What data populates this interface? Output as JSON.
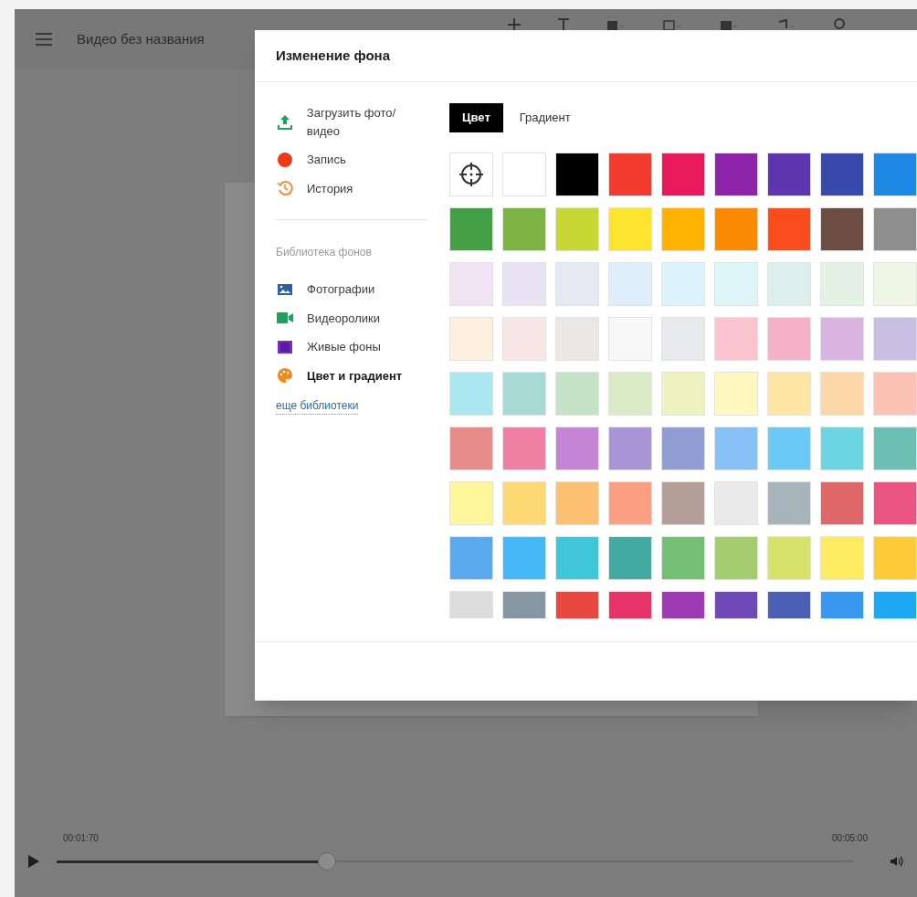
{
  "app_bar": {
    "title": "Видео без названия"
  },
  "dialog": {
    "title": "Изменение фона",
    "sources": [
      {
        "kind": "upload",
        "label": "Загрузить фото/видео"
      },
      {
        "kind": "record",
        "label": "Запись"
      },
      {
        "kind": "history",
        "label": "История"
      }
    ],
    "library_heading": "Библиотека фонов",
    "libraries": [
      {
        "kind": "photos",
        "label": "Фотографии",
        "selected": false
      },
      {
        "kind": "videos",
        "label": "Видеоролики",
        "selected": false
      },
      {
        "kind": "live",
        "label": "Живые фоны",
        "selected": false
      },
      {
        "kind": "palette",
        "label": "Цвет и градиент",
        "selected": true
      }
    ],
    "more_link": "еще библиотеки",
    "tabs": [
      {
        "label": "Цвет",
        "selected": true
      },
      {
        "label": "Градиент",
        "selected": false
      }
    ],
    "swatches": [
      {
        "kind": "picker"
      },
      {
        "kind": "color",
        "color": "#ffffff"
      },
      {
        "kind": "color",
        "color": "#000000"
      },
      {
        "kind": "color",
        "color": "#f33a2f"
      },
      {
        "kind": "color",
        "color": "#e91a5c"
      },
      {
        "kind": "color",
        "color": "#8e24aa"
      },
      {
        "kind": "color",
        "color": "#5e35b1"
      },
      {
        "kind": "color",
        "color": "#3949ab"
      },
      {
        "kind": "color",
        "color": "#1e88e5"
      },
      {
        "kind": "color",
        "color": "#43a047"
      },
      {
        "kind": "color",
        "color": "#7cb342"
      },
      {
        "kind": "color",
        "color": "#c6d632"
      },
      {
        "kind": "color",
        "color": "#fde42e"
      },
      {
        "kind": "color",
        "color": "#ffb300"
      },
      {
        "kind": "color",
        "color": "#fb8a00"
      },
      {
        "kind": "color",
        "color": "#fb4c1e"
      },
      {
        "kind": "color",
        "color": "#6d4c41"
      },
      {
        "kind": "color",
        "color": "#8e8e8e"
      },
      {
        "kind": "color",
        "color": "#f1e3f4"
      },
      {
        "kind": "color",
        "color": "#e8e4f4"
      },
      {
        "kind": "color",
        "color": "#e6e9f4"
      },
      {
        "kind": "color",
        "color": "#deeefa"
      },
      {
        "kind": "color",
        "color": "#dcf3fb"
      },
      {
        "kind": "color",
        "color": "#dcf5f7"
      },
      {
        "kind": "color",
        "color": "#dcefed"
      },
      {
        "kind": "color",
        "color": "#e4f2e5"
      },
      {
        "kind": "color",
        "color": "#eef6e6"
      },
      {
        "kind": "color",
        "color": "#fef0df"
      },
      {
        "kind": "color",
        "color": "#f9e6e6"
      },
      {
        "kind": "color",
        "color": "#ebe7e5"
      },
      {
        "kind": "color",
        "color": "#f8f8f8"
      },
      {
        "kind": "color",
        "color": "#e8e9ec"
      },
      {
        "kind": "color",
        "color": "#fcc4cf"
      },
      {
        "kind": "color",
        "color": "#f4b1c8"
      },
      {
        "kind": "color",
        "color": "#dab4e1"
      },
      {
        "kind": "color",
        "color": "#c9bfe2"
      },
      {
        "kind": "color",
        "color": "#abe7f0"
      },
      {
        "kind": "color",
        "color": "#a8dad5"
      },
      {
        "kind": "color",
        "color": "#c4e2c6"
      },
      {
        "kind": "color",
        "color": "#d9ebc6"
      },
      {
        "kind": "color",
        "color": "#eff3c0"
      },
      {
        "kind": "color",
        "color": "#fff8c0"
      },
      {
        "kind": "color",
        "color": "#fde5a6"
      },
      {
        "kind": "color",
        "color": "#fcd8a8"
      },
      {
        "kind": "color",
        "color": "#fbc3b3"
      },
      {
        "kind": "color",
        "color": "#e88b8b"
      },
      {
        "kind": "color",
        "color": "#f07fa4"
      },
      {
        "kind": "color",
        "color": "#c584d4"
      },
      {
        "kind": "color",
        "color": "#a994d6"
      },
      {
        "kind": "color",
        "color": "#8f9dd2"
      },
      {
        "kind": "color",
        "color": "#86c0f5"
      },
      {
        "kind": "color",
        "color": "#6cc8f5"
      },
      {
        "kind": "color",
        "color": "#6cd5e3"
      },
      {
        "kind": "color",
        "color": "#6bbfb3"
      },
      {
        "kind": "color",
        "color": "#fff59a"
      },
      {
        "kind": "color",
        "color": "#fdd873"
      },
      {
        "kind": "color",
        "color": "#fdc073"
      },
      {
        "kind": "color",
        "color": "#fd9f82"
      },
      {
        "kind": "color",
        "color": "#b39f98"
      },
      {
        "kind": "color",
        "color": "#eaeaea"
      },
      {
        "kind": "color",
        "color": "#a7b4bc"
      },
      {
        "kind": "color",
        "color": "#e06767"
      },
      {
        "kind": "color",
        "color": "#ea5480"
      },
      {
        "kind": "color",
        "color": "#5aaaf0"
      },
      {
        "kind": "color",
        "color": "#44b9f5"
      },
      {
        "kind": "color",
        "color": "#40c6d9"
      },
      {
        "kind": "color",
        "color": "#42aaa0"
      },
      {
        "kind": "color",
        "color": "#74bf74"
      },
      {
        "kind": "color",
        "color": "#a4cd6f"
      },
      {
        "kind": "color",
        "color": "#d6e26a"
      },
      {
        "kind": "color",
        "color": "#fdec62"
      },
      {
        "kind": "color",
        "color": "#fdca38"
      },
      {
        "kind": "color",
        "color": "#dcdcdc"
      },
      {
        "kind": "color",
        "color": "#8497a2"
      },
      {
        "kind": "color",
        "color": "#e84840"
      },
      {
        "kind": "color",
        "color": "#e63468"
      },
      {
        "kind": "color",
        "color": "#9e3ab2"
      },
      {
        "kind": "color",
        "color": "#7049b9"
      },
      {
        "kind": "color",
        "color": "#4b5fb5"
      },
      {
        "kind": "color",
        "color": "#3898ef"
      },
      {
        "kind": "color",
        "color": "#1ca8f2"
      }
    ]
  },
  "player": {
    "current_time": "00:01:70",
    "duration": "00:05:00",
    "level": 0.34
  }
}
